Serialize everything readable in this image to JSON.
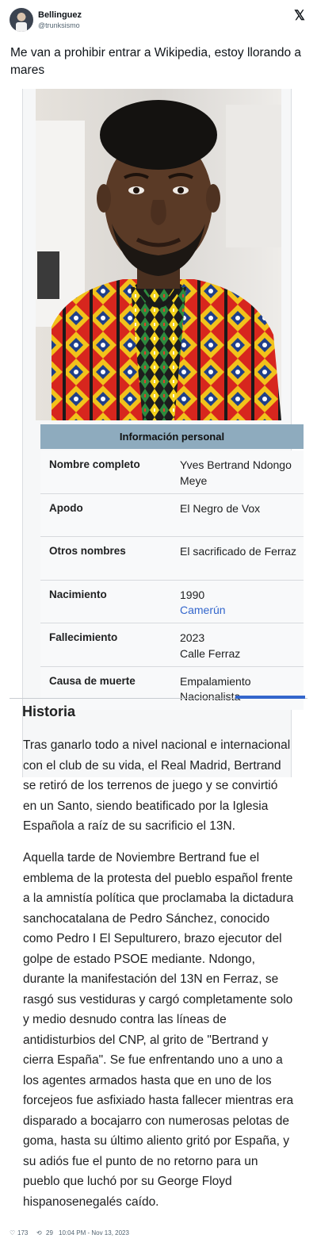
{
  "tweet": {
    "author_name": "Bellinguez",
    "author_handle": "@trunksismo",
    "platform_icon": "x-logo-icon",
    "text": "Me van a prohibir entrar a Wikipedia, estoy llorando a mares",
    "likes": "173",
    "retweets": "29",
    "timestamp": "10:04 PM - Nov 13, 2023"
  },
  "wiki": {
    "infobox_title": "Información personal",
    "rows": [
      {
        "label": "Nombre completo",
        "value": "Yves Bertrand Ndongo Meye"
      },
      {
        "label": "Apodo",
        "value": "El Negro de Vox"
      },
      {
        "label": "Otros nombres",
        "value": "El sacrificado de Ferraz"
      },
      {
        "label": "Nacimiento",
        "value": "1990",
        "link": "Camerún"
      },
      {
        "label": "Fallecimiento",
        "value": "2023",
        "value2": "Calle Ferraz"
      },
      {
        "label": "Causa de muerte",
        "value": "Empalamiento Nacionalista"
      }
    ],
    "section_title": "Historia",
    "paragraph_1": "Tras ganarlo todo a nivel nacional e internacional con el club de su vida, el Real Madrid, Bertrand se retiró de los terrenos de juego y se convirtió en un Santo, siendo beatificado por la Iglesia Española a raíz de su sacrificio el 13N.",
    "paragraph_2": "Aquella tarde de Noviembre Bertrand fue el emblema de la protesta del pueblo español frente a la amnistía política que proclamaba la dictadura sanchocatalana de Pedro Sánchez, conocido como Pedro I El Sepulturero, brazo ejecutor del golpe de estado PSOE mediante. Ndongo, durante la manifestación del 13N en Ferraz, se rasgó sus vestiduras y cargó completamente solo y medio desnudo contra las líneas de antidisturbios del CNP, al grito de \"Bertrand y cierra España\". Se fue enfrentando uno a uno a los agentes armados hasta que en uno de los forcejeos fue asfixiado hasta fallecer mientras era disparado a bocajarro con numerosas pelotas de goma, hasta su último aliento gritó por España, y su adiós fue el punto de no retorno para un pueblo que luchó por su George Floyd hispanosenegalés caído."
  },
  "colors": {
    "infobox_header": "#8eabbe",
    "link": "#3366cc",
    "text": "#202122",
    "muted": "#536471"
  }
}
